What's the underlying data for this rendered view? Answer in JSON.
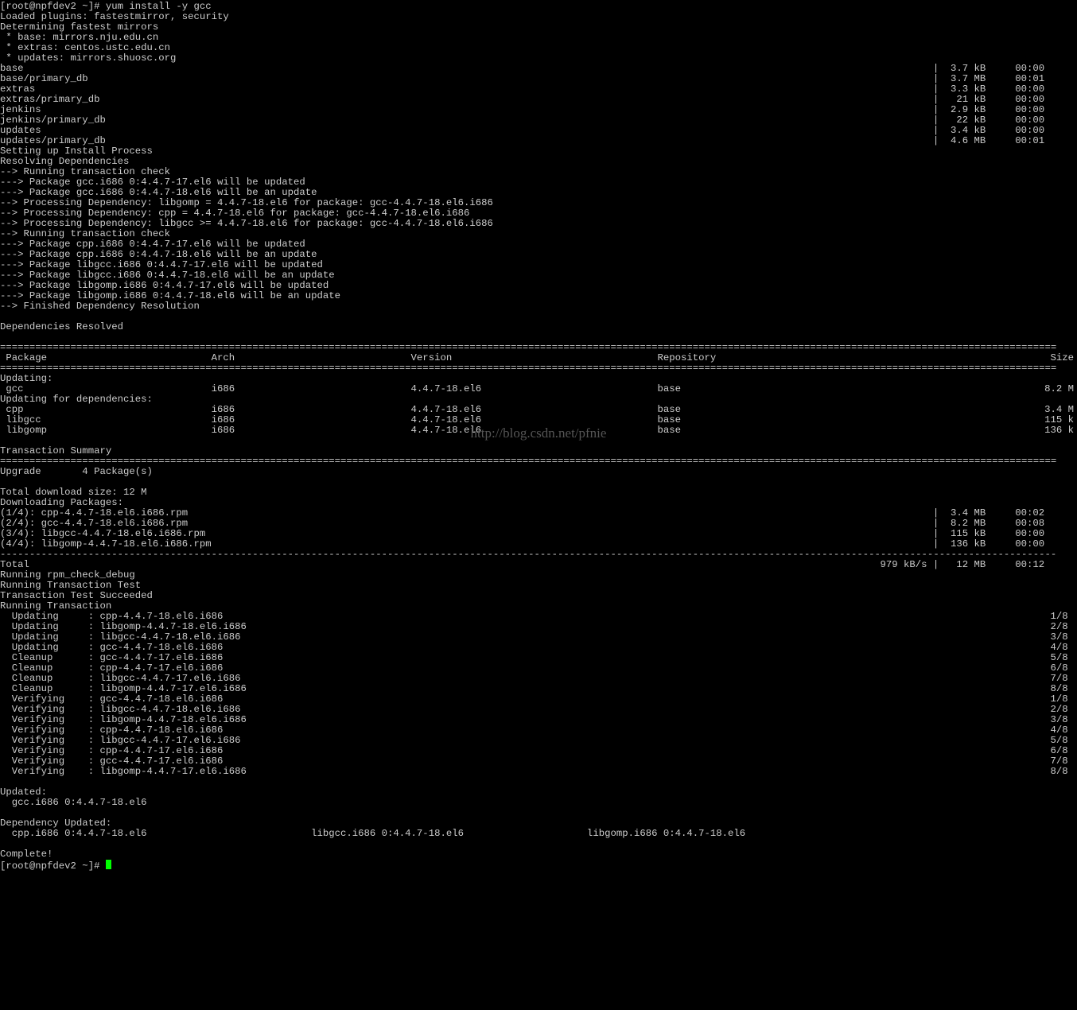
{
  "prompt_start": "[root@npfdev2 ~]# ",
  "cmd": "yum install -y gcc",
  "intro": [
    "Loaded plugins: fastestmirror, security",
    "Determining fastest mirrors",
    " * base: mirrors.nju.edu.cn",
    " * extras: centos.ustc.edu.cn",
    " * updates: mirrors.shuosc.org"
  ],
  "repo_rows": [
    {
      "l": "base",
      "s": "3.7 kB",
      "t": "00:00"
    },
    {
      "l": "base/primary_db",
      "s": "3.7 MB",
      "t": "00:01"
    },
    {
      "l": "extras",
      "s": "3.3 kB",
      "t": "00:00"
    },
    {
      "l": "extras/primary_db",
      "s": "21 kB",
      "t": "00:00"
    },
    {
      "l": "jenkins",
      "s": "2.9 kB",
      "t": "00:00"
    },
    {
      "l": "jenkins/primary_db",
      "s": "22 kB",
      "t": "00:00"
    },
    {
      "l": "updates",
      "s": "3.4 kB",
      "t": "00:00"
    },
    {
      "l": "updates/primary_db",
      "s": "4.6 MB",
      "t": "00:01"
    }
  ],
  "resolve": [
    "Setting up Install Process",
    "Resolving Dependencies",
    "--> Running transaction check",
    "---> Package gcc.i686 0:4.4.7-17.el6 will be updated",
    "---> Package gcc.i686 0:4.4.7-18.el6 will be an update",
    "--> Processing Dependency: libgomp = 4.4.7-18.el6 for package: gcc-4.4.7-18.el6.i686",
    "--> Processing Dependency: cpp = 4.4.7-18.el6 for package: gcc-4.4.7-18.el6.i686",
    "--> Processing Dependency: libgcc >= 4.4.7-18.el6 for package: gcc-4.4.7-18.el6.i686",
    "--> Running transaction check",
    "---> Package cpp.i686 0:4.4.7-17.el6 will be updated",
    "---> Package cpp.i686 0:4.4.7-18.el6 will be an update",
    "---> Package libgcc.i686 0:4.4.7-17.el6 will be updated",
    "---> Package libgcc.i686 0:4.4.7-18.el6 will be an update",
    "---> Package libgomp.i686 0:4.4.7-17.el6 will be updated",
    "---> Package libgomp.i686 0:4.4.7-18.el6 will be an update",
    "--> Finished Dependency Resolution",
    "",
    "Dependencies Resolved",
    ""
  ],
  "hdr": {
    "p": " Package",
    "a": "Arch",
    "v": "Version",
    "r": "Repository",
    "s": "Size"
  },
  "sec1": "Updating:",
  "rows1": [
    {
      "p": " gcc",
      "a": "i686",
      "v": "4.4.7-18.el6",
      "r": "base",
      "s": "8.2 M"
    }
  ],
  "sec2": "Updating for dependencies:",
  "rows2": [
    {
      "p": " cpp",
      "a": "i686",
      "v": "4.4.7-18.el6",
      "r": "base",
      "s": "3.4 M"
    },
    {
      "p": " libgcc",
      "a": "i686",
      "v": "4.4.7-18.el6",
      "r": "base",
      "s": "115 k"
    },
    {
      "p": " libgomp",
      "a": "i686",
      "v": "4.4.7-18.el6",
      "r": "base",
      "s": "136 k"
    }
  ],
  "tx_summary_label": "Transaction Summary",
  "upgrade_line": "Upgrade       4 Package(s)",
  "dlsize": "Total download size: 12 M",
  "dlhdr": "Downloading Packages:",
  "dl_rows": [
    {
      "l": "(1/4): cpp-4.4.7-18.el6.i686.rpm",
      "s": "3.4 MB",
      "t": "00:02"
    },
    {
      "l": "(2/4): gcc-4.4.7-18.el6.i686.rpm",
      "s": "8.2 MB",
      "t": "00:08"
    },
    {
      "l": "(3/4): libgcc-4.4.7-18.el6.i686.rpm",
      "s": "115 kB",
      "t": "00:00"
    },
    {
      "l": "(4/4): libgomp-4.4.7-18.el6.i686.rpm",
      "s": "136 kB",
      "t": "00:00"
    }
  ],
  "total_left": "Total",
  "total_right": "979 kB/s |   12 MB     00:12     ",
  "tx_run": [
    "Running rpm_check_debug",
    "Running Transaction Test",
    "Transaction Test Succeeded",
    "Running Transaction"
  ],
  "steps": [
    {
      "a": "Updating",
      "p": "cpp-4.4.7-18.el6.i686",
      "n": "1/8"
    },
    {
      "a": "Updating",
      "p": "libgomp-4.4.7-18.el6.i686",
      "n": "2/8"
    },
    {
      "a": "Updating",
      "p": "libgcc-4.4.7-18.el6.i686",
      "n": "3/8"
    },
    {
      "a": "Updating",
      "p": "gcc-4.4.7-18.el6.i686",
      "n": "4/8"
    },
    {
      "a": "Cleanup",
      "p": "gcc-4.4.7-17.el6.i686",
      "n": "5/8"
    },
    {
      "a": "Cleanup",
      "p": "cpp-4.4.7-17.el6.i686",
      "n": "6/8"
    },
    {
      "a": "Cleanup",
      "p": "libgcc-4.4.7-17.el6.i686",
      "n": "7/8"
    },
    {
      "a": "Cleanup",
      "p": "libgomp-4.4.7-17.el6.i686",
      "n": "8/8"
    },
    {
      "a": "Verifying",
      "p": "gcc-4.4.7-18.el6.i686",
      "n": "1/8"
    },
    {
      "a": "Verifying",
      "p": "libgcc-4.4.7-18.el6.i686",
      "n": "2/8"
    },
    {
      "a": "Verifying",
      "p": "libgomp-4.4.7-18.el6.i686",
      "n": "3/8"
    },
    {
      "a": "Verifying",
      "p": "cpp-4.4.7-18.el6.i686",
      "n": "4/8"
    },
    {
      "a": "Verifying",
      "p": "libgcc-4.4.7-17.el6.i686",
      "n": "5/8"
    },
    {
      "a": "Verifying",
      "p": "cpp-4.4.7-17.el6.i686",
      "n": "6/8"
    },
    {
      "a": "Verifying",
      "p": "gcc-4.4.7-17.el6.i686",
      "n": "7/8"
    },
    {
      "a": "Verifying",
      "p": "libgomp-4.4.7-17.el6.i686",
      "n": "8/8"
    }
  ],
  "updated_hdr": "Updated:",
  "updated_line": "  gcc.i686 0:4.4.7-18.el6                                                                                                                                                       ",
  "dep_updated_hdr": "Dependency Updated:",
  "dep_updated_cols": [
    "  cpp.i686 0:4.4.7-18.el6",
    "libgcc.i686 0:4.4.7-18.el6",
    "libgomp.i686 0:4.4.7-18.el6"
  ],
  "complete": "Complete!",
  "prompt_end": "[root@npfdev2 ~]# ",
  "watermark": "http://blog.csdn.net/pfnie"
}
